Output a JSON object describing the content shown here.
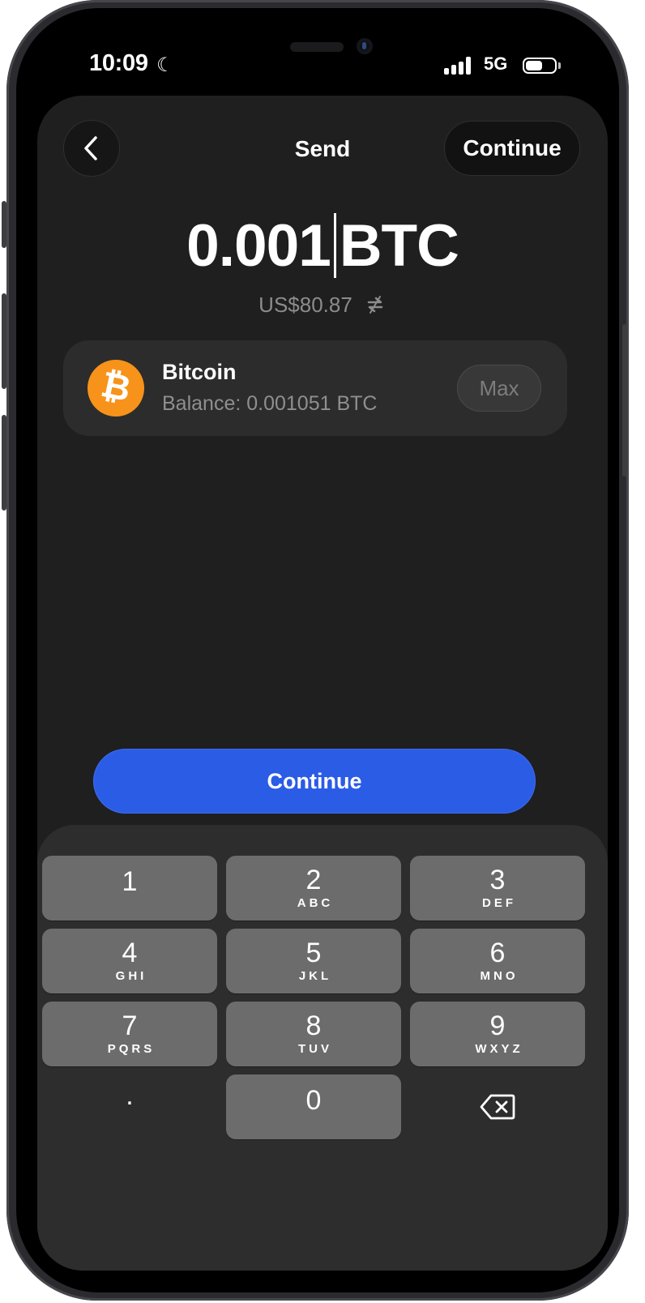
{
  "status_bar": {
    "time": "10:09",
    "network": "5G",
    "moon_icon": "moon-icon",
    "signal_icon": "signal-icon",
    "battery_icon": "battery-icon",
    "battery_level": 0.6
  },
  "header": {
    "back_icon": "chevron-left-icon",
    "title": "Send",
    "continue_label": "Continue"
  },
  "amount": {
    "value": "0.001",
    "unit": "BTC",
    "fiat": "US$80.87",
    "swap_icon": "swap-arrows-icon"
  },
  "asset": {
    "icon": "bitcoin-icon",
    "logo_glyph": "₿",
    "logo_color": "#f7931a",
    "name": "Bitcoin",
    "balance": "Balance: 0.001051 BTC",
    "max_label": "Max"
  },
  "continue_button": {
    "label": "Continue",
    "color": "#2b5ce6"
  },
  "keypad": {
    "keys": [
      {
        "digit": "1",
        "letters": ""
      },
      {
        "digit": "2",
        "letters": "ABC"
      },
      {
        "digit": "3",
        "letters": "DEF"
      },
      {
        "digit": "4",
        "letters": "GHI"
      },
      {
        "digit": "5",
        "letters": "JKL"
      },
      {
        "digit": "6",
        "letters": "MNO"
      },
      {
        "digit": "7",
        "letters": "PQRS"
      },
      {
        "digit": "8",
        "letters": "TUV"
      },
      {
        "digit": "9",
        "letters": "WXYZ"
      },
      {
        "digit": ".",
        "letters": ""
      },
      {
        "digit": "0",
        "letters": ""
      }
    ],
    "delete_icon": "backspace-icon"
  }
}
